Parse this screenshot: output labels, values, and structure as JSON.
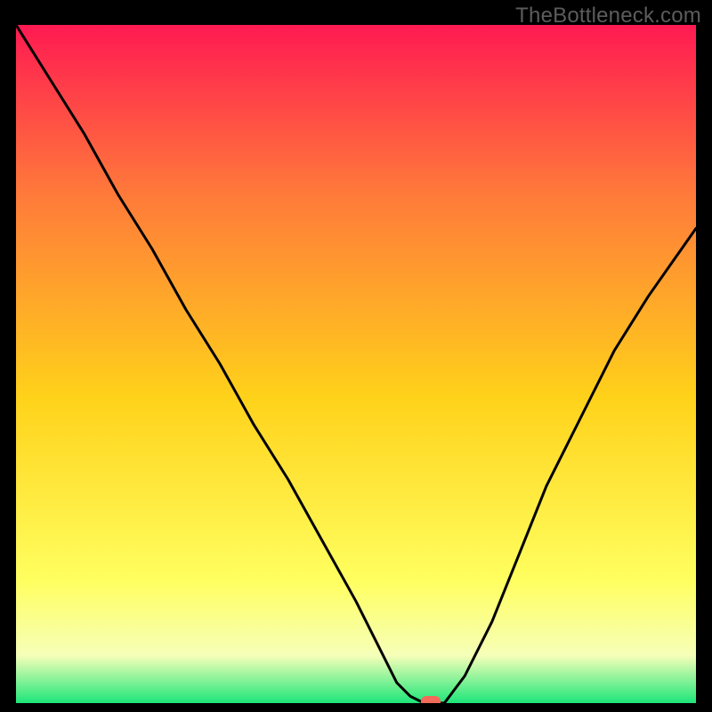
{
  "watermark": "TheBottleneck.com",
  "colors": {
    "black": "#000000",
    "curve": "#000000",
    "marker": "#f46a5a",
    "grad_top": "#ff1a52",
    "grad_mid_upper": "#ff7a3a",
    "grad_mid": "#ffd21a",
    "grad_mid_lower": "#ffff60",
    "grad_pale": "#f6ffb8",
    "grad_green": "#1de67a"
  },
  "chart_data": {
    "type": "line",
    "title": "",
    "xlabel": "",
    "ylabel": "",
    "xlim": [
      0,
      100
    ],
    "ylim": [
      0,
      100
    ],
    "grid": false,
    "legend": false,
    "series": [
      {
        "name": "bottleneck-curve",
        "x": [
          0,
          5,
          10,
          15,
          20,
          25,
          30,
          35,
          40,
          45,
          50,
          54,
          56,
          58,
          60,
          63,
          66,
          70,
          74,
          78,
          83,
          88,
          93,
          100
        ],
        "values": [
          100,
          92,
          84,
          75,
          67,
          58,
          50,
          41,
          33,
          24,
          15,
          7,
          3,
          1,
          0,
          0,
          4,
          12,
          22,
          32,
          42,
          52,
          60,
          70
        ]
      }
    ],
    "marker": {
      "x": 61,
      "y": 0,
      "name": "optimal-point"
    }
  }
}
